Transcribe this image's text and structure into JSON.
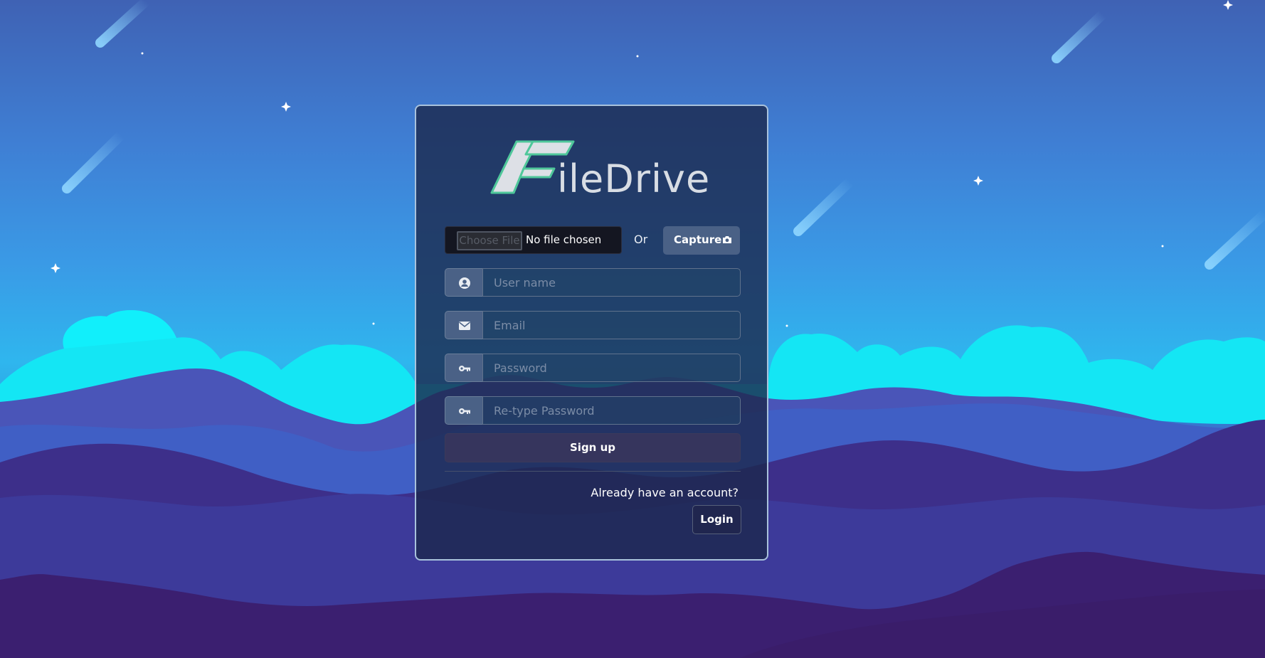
{
  "brand": {
    "logo_text": "ileDrive",
    "logo_letter": "F",
    "accent": "#4fc79a"
  },
  "upload": {
    "choose_file_label": "Choose File",
    "no_file_text": "No file chosen",
    "or_label": "Or",
    "capture_label": "Capture"
  },
  "form": {
    "username_placeholder": "User name",
    "email_placeholder": "Email",
    "password_placeholder": "Password",
    "retype_password_placeholder": "Re-type Password",
    "signup_label": "Sign up"
  },
  "footer": {
    "already_text": "Already have an account?",
    "login_label": "Login"
  },
  "icons": {
    "username": "user-circle-icon",
    "email": "envelope-icon",
    "password": "key-icon",
    "retype_password": "key-icon",
    "capture": "camera-icon"
  },
  "colors": {
    "card_bg": "#1c284c",
    "addon_bg": "#4a6186",
    "file_input_bg": "#141621",
    "signup_bg": "#3a365c"
  }
}
